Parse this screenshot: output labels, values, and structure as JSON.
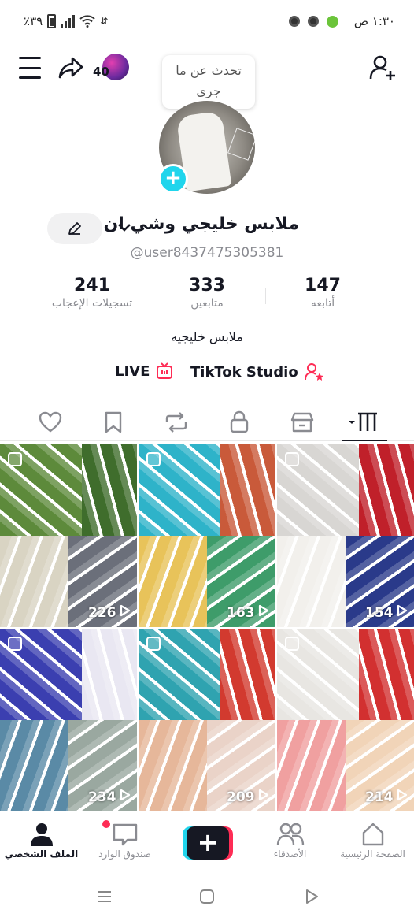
{
  "status_bar": {
    "battery_text": "٪٣٩",
    "time": "١:٣٠ ص"
  },
  "header": {
    "friends_count": "40",
    "bubble_line1": "تحدث عن ما",
    "bubble_line2": "جرى"
  },
  "profile": {
    "display_name": "ملابس خليجي وشي ان",
    "username": "@user8437475305381",
    "bio": "ملابس خليجيه",
    "stats": [
      {
        "value": "241",
        "label": "تسجيلات الإعجاب"
      },
      {
        "value": "333",
        "label": "متابعين"
      },
      {
        "value": "147",
        "label": "أتابعه"
      }
    ],
    "links": {
      "live": "LIVE",
      "studio": "TikTok Studio"
    }
  },
  "tabs": [
    "videos-grid-icon",
    "shop-icon",
    "lock-icon",
    "repost-icon",
    "bookmark-icon",
    "heart-icon"
  ],
  "videos": [
    {
      "views": "226",
      "colors": [
        "#5d8a3b",
        "#3f6d2c",
        "#d9d4c3",
        "#6b6f7a"
      ]
    },
    {
      "views": "163",
      "colors": [
        "#2eb3c9",
        "#c95a3a",
        "#e8c35a",
        "#3e9c6a"
      ]
    },
    {
      "views": "154",
      "colors": [
        "#d8d6d3",
        "#c0202a",
        "#f2f0ec",
        "#2a3a8a"
      ]
    },
    {
      "views": "234",
      "colors": [
        "#3b3fb0",
        "#e9e7f2",
        "#5a8aa6",
        "#9aa8a0"
      ]
    },
    {
      "views": "209",
      "colors": [
        "#2fa3b0",
        "#d23a2f",
        "#e6b79a",
        "#ead3c8"
      ]
    },
    {
      "views": "214",
      "colors": [
        "#e8e6e2",
        "#d23030",
        "#f0a0a0",
        "#f1d4b8"
      ]
    }
  ],
  "bottom_nav": {
    "home": "الصفحة الرئيسية",
    "friends": "الأصدقاء",
    "inbox": "صندوق الوارد",
    "profile": "الملف الشخصي"
  },
  "colors": {
    "accent_cyan": "#20d5ec",
    "accent_red": "#fe2c55",
    "text": "#161823",
    "muted": "#8a8b91"
  }
}
